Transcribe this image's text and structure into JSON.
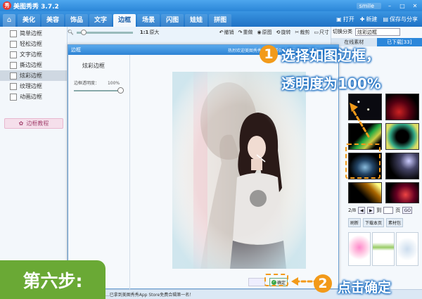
{
  "window": {
    "title": "美图秀秀 3.7.2",
    "user": "smile",
    "logo": "秀"
  },
  "menu": {
    "tabs": [
      {
        "label": "美化",
        "active": false
      },
      {
        "label": "美容",
        "active": false
      },
      {
        "label": "饰品",
        "active": false
      },
      {
        "label": "文字",
        "active": false
      },
      {
        "label": "边框",
        "active": true
      },
      {
        "label": "场景",
        "active": false
      },
      {
        "label": "闪图",
        "active": false
      },
      {
        "label": "娃娃",
        "active": false
      },
      {
        "label": "拼图",
        "active": false
      }
    ],
    "open_label": "打开",
    "new_label": "新建",
    "save_label": "保存与分享"
  },
  "toolbar": {
    "original_size": "原大",
    "undo": "撤销",
    "redo": "重做",
    "original": "原图",
    "rotate": "旋转",
    "crop": "裁剪",
    "size": "尺寸"
  },
  "sidebar": {
    "items": [
      {
        "label": "简单边框",
        "active": false
      },
      {
        "label": "轻松边框",
        "active": false
      },
      {
        "label": "文字边框",
        "active": false
      },
      {
        "label": "撕边边框",
        "active": false
      },
      {
        "label": "炫彩边框",
        "active": true
      },
      {
        "label": "纹理边框",
        "active": false
      },
      {
        "label": "动画边框",
        "active": false
      }
    ],
    "tutorial": "边框教程"
  },
  "rightpanel": {
    "category_label": "切换分类",
    "category_value": "炫彩边框",
    "tab_online": "在线素材",
    "tab_downloaded": "已下载[33]",
    "page": "2/8",
    "goto_label": "到",
    "page_unit": "页",
    "go_label": "GO",
    "btn_refresh": "刷新",
    "btn_download_page": "下载本页",
    "btn_material": "素材包"
  },
  "dialog": {
    "title": "边框",
    "promo": "热烈欢迎美图秀秀好用，要告诉你的亲朋好友们哦~",
    "frame_name": "炫彩边框",
    "opacity_label": "边框透明度：",
    "opacity_value": "100%",
    "opacity_fraction": 1.0,
    "ok_label": "确定"
  },
  "status": {
    "text": "...已拿到美图秀秀App Store免费合辑第一名！"
  },
  "annotations": {
    "step": "第六步:",
    "n1": "1",
    "line1": "选择如图边框，",
    "line2": "透明度为100%",
    "n2": "2",
    "confirm": "点击确定"
  },
  "colors": {
    "accent": "#2b86d8",
    "annotation": "#f29a1a",
    "step_badge": "#6aa935"
  }
}
